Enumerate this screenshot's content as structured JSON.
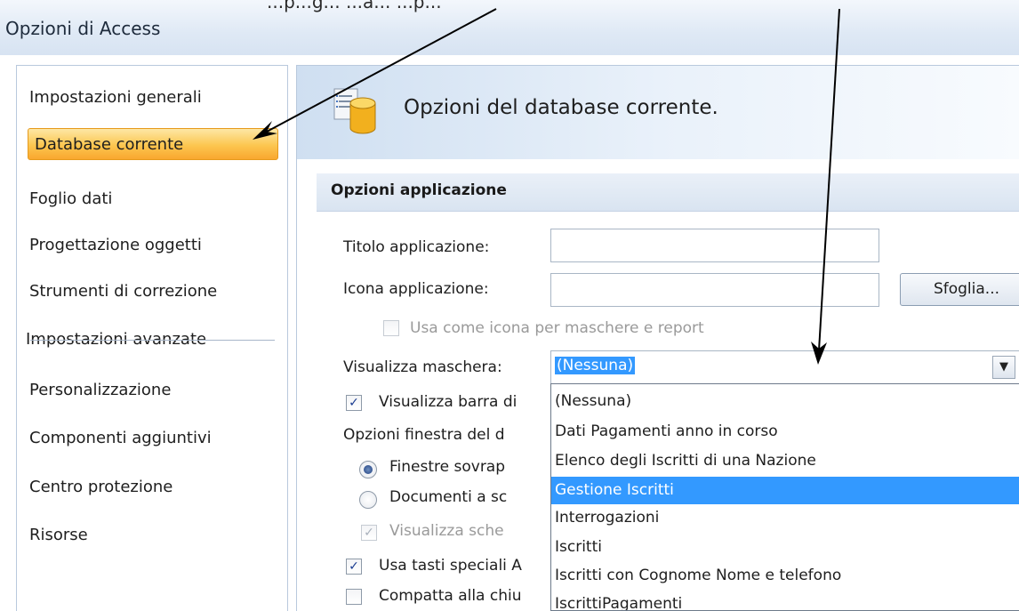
{
  "window": {
    "title": "Opzioni di Access"
  },
  "top_text": "...p...g... ...a... ...p...",
  "nav": {
    "items": [
      {
        "label": "Impostazioni generali"
      },
      {
        "label": "Database corrente"
      },
      {
        "label": "Foglio dati"
      },
      {
        "label": "Progettazione oggetti"
      },
      {
        "label": "Strumenti di correzione"
      },
      {
        "label": "Impostazioni avanzate"
      },
      {
        "label": "Personalizzazione"
      },
      {
        "label": "Componenti aggiuntivi"
      },
      {
        "label": "Centro protezione"
      },
      {
        "label": "Risorse"
      }
    ],
    "active_index": 1
  },
  "header": {
    "title": "Opzioni del database corrente.",
    "icon": "database-options-icon"
  },
  "section": {
    "title": "Opzioni applicazione"
  },
  "app_title": {
    "label": "Titolo applicazione:",
    "value": ""
  },
  "app_icon": {
    "label": "Icona applicazione:",
    "value": "",
    "browse_label": "Sfoglia..."
  },
  "use_as_icon": {
    "label": "Usa come icona per maschere e report",
    "checked": false,
    "enabled": false
  },
  "display_form": {
    "label": "Visualizza maschera:",
    "value": "(Nessuna)",
    "options": [
      "(Nessuna)",
      "Dati Pagamenti anno in corso",
      "Elenco degli Iscritti di una Nazione",
      "Gestione Iscritti",
      "Interrogazioni",
      "Iscritti",
      "Iscritti con Cognome Nome e telefono",
      "IscrittiPagamenti"
    ],
    "highlighted_index": 3
  },
  "status_bar": {
    "label": "Visualizza barra di",
    "checked": true
  },
  "doc_window": {
    "label": "Opzioni finestra del d"
  },
  "overlap": {
    "label": "Finestre sovrap",
    "selected": true
  },
  "tabbed": {
    "label": "Documenti a sc",
    "selected": false
  },
  "doc_tabs": {
    "label": "Visualizza sche",
    "checked": true,
    "enabled": false
  },
  "special_keys": {
    "label": "Usa tasti speciali A",
    "checked": true
  },
  "compact": {
    "label": "Compatta alla chiu",
    "checked": false
  },
  "colors": {
    "accent_orange": "#fcc64f",
    "selection_blue": "#3399ff",
    "arrow_black": "#000000"
  }
}
